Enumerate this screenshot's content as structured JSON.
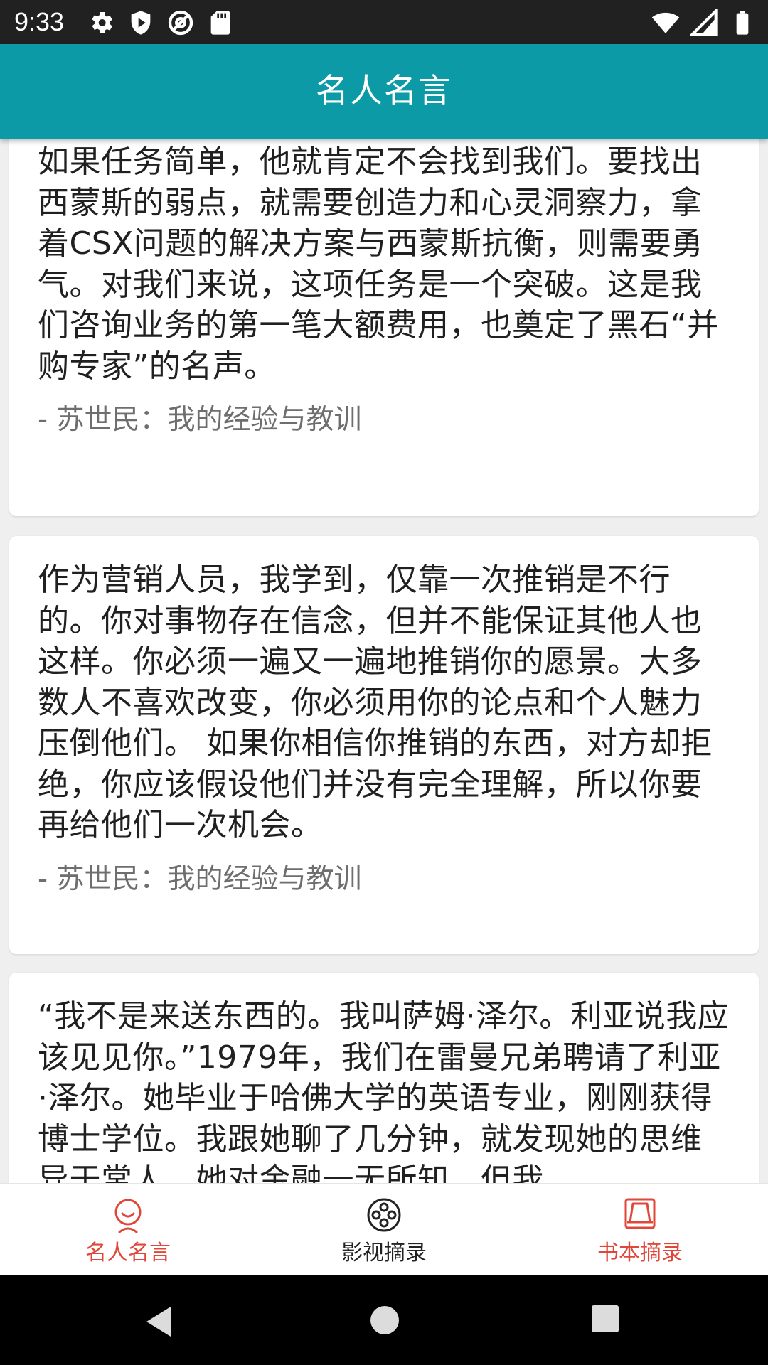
{
  "status_bar": {
    "time": "9:33",
    "left_icons": [
      "gear-icon",
      "shield-icon",
      "at-sign-icon",
      "sd-card-icon"
    ],
    "right_icons": [
      "wifi-icon",
      "cell-signal-icon",
      "battery-icon"
    ]
  },
  "app_bar": {
    "title": "名人名言"
  },
  "quotes": [
    {
      "text": "如果任务简单，他就肯定不会找到我们。要找出西蒙斯的弱点，就需要创造力和心灵洞察力，拿着CSX问题的解决方案与西蒙斯抗衡，则需要勇气。对我们来说，这项任务是一个突破。这是我们咨询业务的第一笔大额费用，也奠定了黑石“并购专家”的名声。",
      "source": "- 苏世民：我的经验与教训"
    },
    {
      "text": "作为营销人员，我学到，仅靠一次推销是不行的。你对事物存在信念，但并不能保证其他人也这样。你必须一遍又一遍地推销你的愿景。大多数人不喜欢改变，你必须用你的论点和个人魅力压倒他们。 如果你相信你推销的东西，对方却拒绝，你应该假设他们并没有完全理解，所以你要再给他们一次机会。",
      "source": "- 苏世民：我的经验与教训"
    },
    {
      "text": "“我不是来送东西的。我叫萨姆·泽尔。利亚说我应该见见你。”1979年，我们在雷曼兄弟聘请了利亚·泽尔。她毕业于哈佛大学的英语专业，刚刚获得博士学位。我跟她聊了几分钟，就发现她的思维异于常人，她对金融一无所知，但我",
      "source": ""
    }
  ],
  "bottom_nav": {
    "items": [
      {
        "label": "名人名言",
        "icon": "smile-face-icon",
        "color": "#e0473b"
      },
      {
        "label": "影视摘录",
        "icon": "film-reel-icon",
        "color": "#222222"
      },
      {
        "label": "书本摘录",
        "icon": "book-stand-icon",
        "color": "#e0473b"
      }
    ]
  },
  "system_nav": {
    "icons": [
      "back-icon",
      "home-icon",
      "recents-icon"
    ]
  },
  "colors": {
    "app_bar": "#0b9aa6",
    "accent": "#e0473b",
    "status_bar": "#212121"
  }
}
